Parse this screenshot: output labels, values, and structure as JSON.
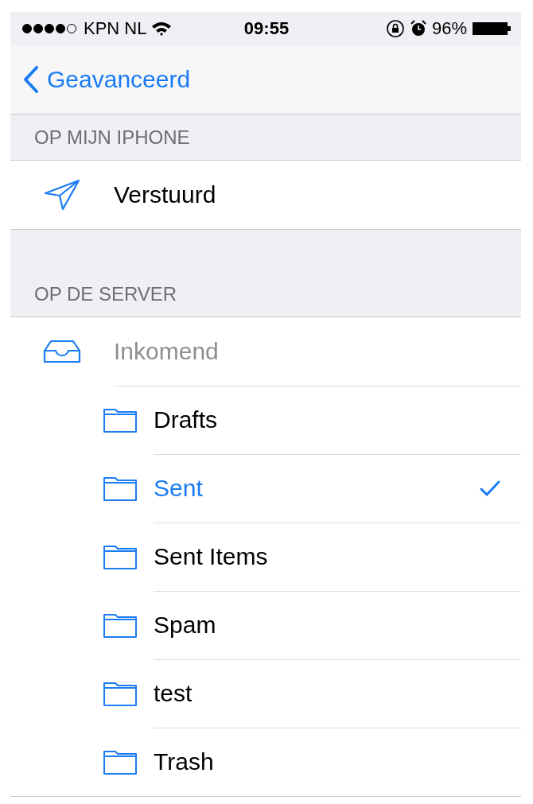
{
  "status_bar": {
    "carrier": "KPN NL",
    "time": "09:55",
    "battery": "96%"
  },
  "nav": {
    "back_label": "Geavanceerd"
  },
  "sections": [
    {
      "header": "OP MIJN IPHONE",
      "items": [
        {
          "label": "Verstuurd",
          "kind": "sent",
          "disabled": false,
          "selected": false
        }
      ]
    },
    {
      "header": "OP DE SERVER",
      "items": [
        {
          "label": "Inkomend",
          "kind": "inbox",
          "disabled": true,
          "selected": false,
          "children": [
            {
              "label": "Drafts",
              "kind": "folder",
              "disabled": false,
              "selected": false
            },
            {
              "label": "Sent",
              "kind": "folder",
              "disabled": false,
              "selected": true
            },
            {
              "label": "Sent Items",
              "kind": "folder",
              "disabled": false,
              "selected": false
            },
            {
              "label": "Spam",
              "kind": "folder",
              "disabled": false,
              "selected": false
            },
            {
              "label": "test",
              "kind": "folder",
              "disabled": false,
              "selected": false
            },
            {
              "label": "Trash",
              "kind": "folder",
              "disabled": false,
              "selected": false
            }
          ]
        }
      ]
    }
  ]
}
